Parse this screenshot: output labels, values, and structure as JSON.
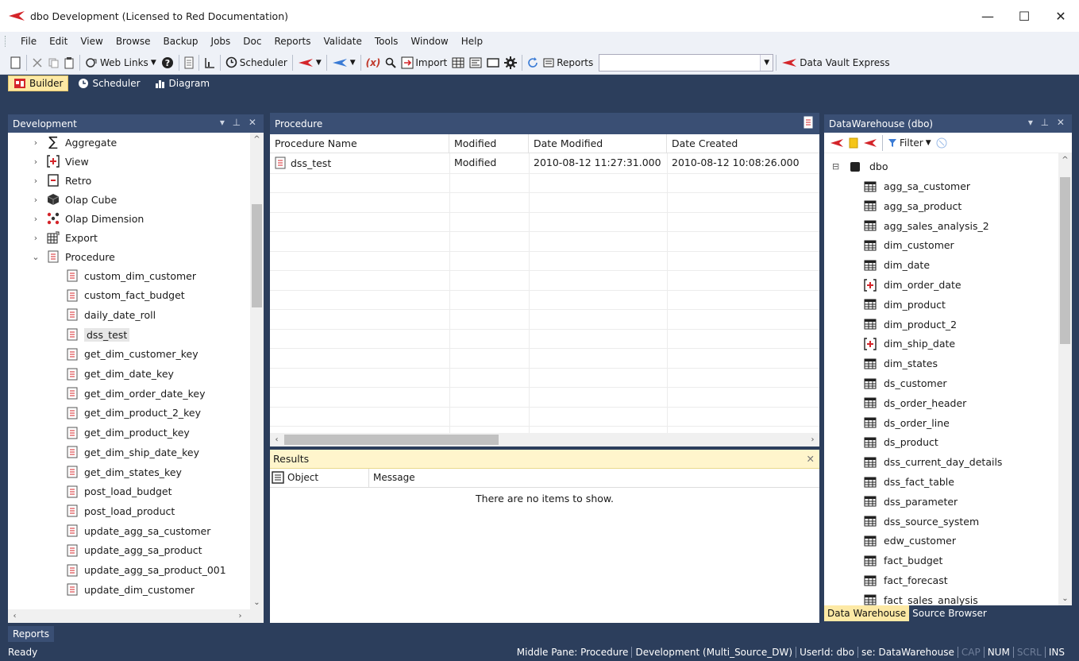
{
  "window": {
    "title": "dbo Development  (Licensed to Red Documentation)",
    "controls": [
      "—",
      "☐",
      "✕"
    ]
  },
  "menu": [
    "File",
    "Edit",
    "View",
    "Browse",
    "Backup",
    "Jobs",
    "Doc",
    "Reports",
    "Validate",
    "Tools",
    "Window",
    "Help"
  ],
  "toolbar": {
    "web_links": "Web Links",
    "scheduler": "Scheduler",
    "import": "Import",
    "reports": "Reports",
    "combo_value": "",
    "data_vault": "Data Vault Express"
  },
  "ribbon_tabs": [
    {
      "label": "Builder",
      "active": true
    },
    {
      "label": "Scheduler",
      "active": false
    },
    {
      "label": "Diagram",
      "active": false
    }
  ],
  "left_panel": {
    "title": "Development",
    "controls": "▾ ⊥ ✕",
    "categories": [
      {
        "label": "Aggregate",
        "icon": "sigma-icon",
        "expanded": false
      },
      {
        "label": "View",
        "icon": "view-icon",
        "expanded": false
      },
      {
        "label": "Retro",
        "icon": "retro-icon",
        "expanded": false
      },
      {
        "label": "Olap Cube",
        "icon": "cube-icon",
        "expanded": false
      },
      {
        "label": "Olap Dimension",
        "icon": "dimension-icon",
        "expanded": false
      },
      {
        "label": "Export",
        "icon": "export-icon",
        "expanded": false
      },
      {
        "label": "Procedure",
        "icon": "procedure-icon",
        "expanded": true
      }
    ],
    "procedures": [
      "custom_dim_customer",
      "custom_fact_budget",
      "daily_date_roll",
      "dss_test",
      "get_dim_customer_key",
      "get_dim_date_key",
      "get_dim_order_date_key",
      "get_dim_product_2_key",
      "get_dim_product_key",
      "get_dim_ship_date_key",
      "get_dim_states_key",
      "post_load_budget",
      "post_load_product",
      "update_agg_sa_customer",
      "update_agg_sa_product",
      "update_agg_sa_product_001",
      "update_dim_customer"
    ],
    "selected": "dss_test"
  },
  "middle_panel": {
    "title": "Procedure",
    "columns": [
      "Procedure Name",
      "Modified",
      "Date Modified",
      "Date Created"
    ],
    "rows": [
      [
        "dss_test",
        "Modified",
        "2010-08-12 11:27:31.000",
        "2010-08-12 10:08:26.000"
      ]
    ]
  },
  "results_panel": {
    "title": "Results",
    "columns": [
      "Object",
      "Message"
    ],
    "empty_text": "There are no items to show."
  },
  "right_panel": {
    "title": "DataWarehouse (dbo)",
    "filter_label": "Filter",
    "root": "dbo",
    "items": [
      {
        "label": "agg_sa_customer",
        "icon": "table-icon"
      },
      {
        "label": "agg_sa_product",
        "icon": "table-icon"
      },
      {
        "label": "agg_sales_analysis_2",
        "icon": "table-icon"
      },
      {
        "label": "dim_customer",
        "icon": "table-icon"
      },
      {
        "label": "dim_date",
        "icon": "table-icon"
      },
      {
        "label": "dim_order_date",
        "icon": "view-icon"
      },
      {
        "label": "dim_product",
        "icon": "table-icon"
      },
      {
        "label": "dim_product_2",
        "icon": "table-icon"
      },
      {
        "label": "dim_ship_date",
        "icon": "view-icon"
      },
      {
        "label": "dim_states",
        "icon": "table-icon"
      },
      {
        "label": "ds_customer",
        "icon": "table-icon"
      },
      {
        "label": "ds_order_header",
        "icon": "table-icon"
      },
      {
        "label": "ds_order_line",
        "icon": "table-icon"
      },
      {
        "label": "ds_product",
        "icon": "table-icon"
      },
      {
        "label": "dss_current_day_details",
        "icon": "table-icon"
      },
      {
        "label": "dss_fact_table",
        "icon": "table-icon"
      },
      {
        "label": "dss_parameter",
        "icon": "table-icon"
      },
      {
        "label": "dss_source_system",
        "icon": "table-icon"
      },
      {
        "label": "edw_customer",
        "icon": "table-icon"
      },
      {
        "label": "fact_budget",
        "icon": "table-icon"
      },
      {
        "label": "fact_forecast",
        "icon": "table-icon"
      },
      {
        "label": "fact_sales_analysis",
        "icon": "table-icon"
      }
    ],
    "tabs": [
      {
        "label": "Data Warehouse",
        "active": true
      },
      {
        "label": "Source Browser",
        "active": false
      }
    ]
  },
  "bottom_tab": "Reports",
  "status": {
    "ready": "Ready",
    "segments": [
      {
        "text": "Middle Pane: Procedure",
        "dim": false
      },
      {
        "text": "Development (Multi_Source_DW)",
        "dim": false
      },
      {
        "text": "UserId: dbo",
        "dim": false
      },
      {
        "text": "se: DataWarehouse",
        "dim": false
      },
      {
        "text": "CAP",
        "dim": true
      },
      {
        "text": "NUM",
        "dim": false
      },
      {
        "text": "SCRL",
        "dim": true
      },
      {
        "text": "INS",
        "dim": false
      }
    ]
  },
  "colors": {
    "frame": "#2c3e5c",
    "panel_header": "#3a4f74",
    "active_tab": "#fde9a5",
    "brand_red": "#d4252a"
  }
}
